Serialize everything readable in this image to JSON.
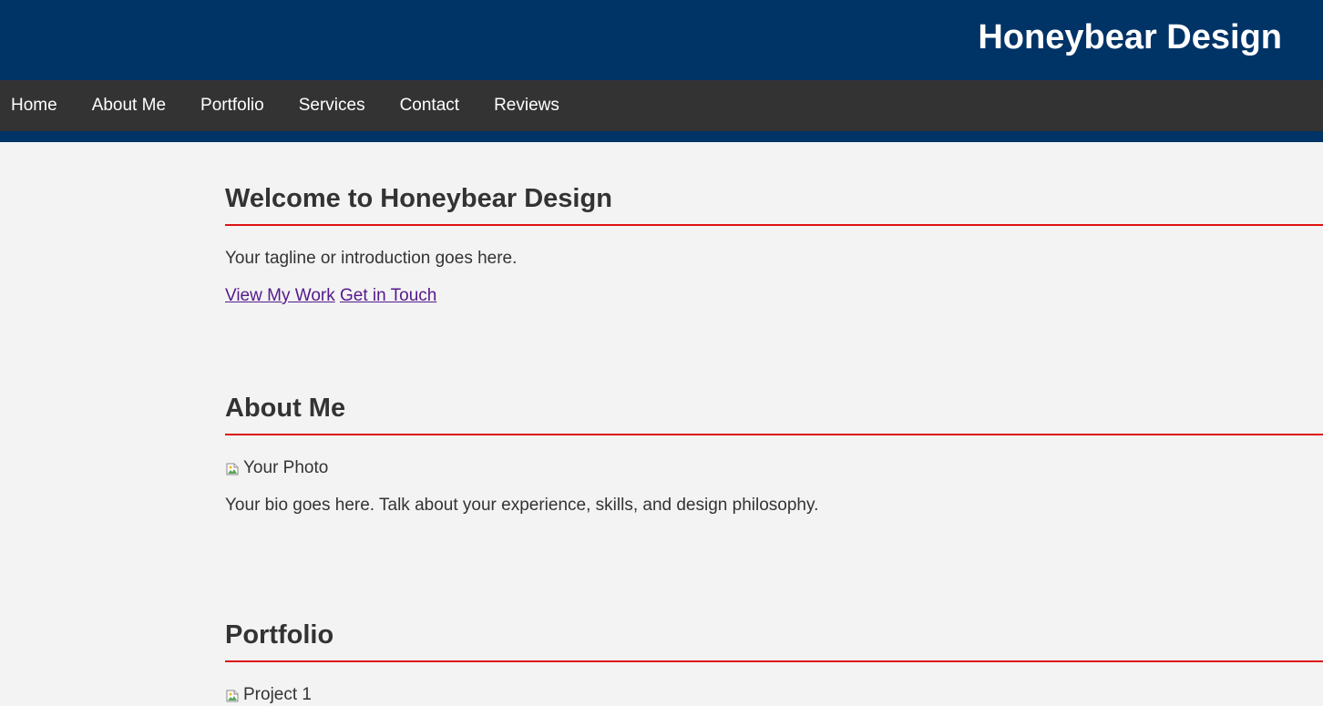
{
  "header": {
    "title": "Honeybear Design"
  },
  "nav": {
    "items": [
      {
        "label": "Home"
      },
      {
        "label": "About Me"
      },
      {
        "label": "Portfolio"
      },
      {
        "label": "Services"
      },
      {
        "label": "Contact"
      },
      {
        "label": "Reviews"
      }
    ]
  },
  "sections": {
    "welcome": {
      "title": "Welcome to Honeybear Design",
      "tagline": "Your tagline or introduction goes here.",
      "links": [
        {
          "label": "View My Work"
        },
        {
          "label": "Get in Touch"
        }
      ]
    },
    "about": {
      "title": "About Me",
      "photo_alt": "Your Photo",
      "bio": "Your bio goes here. Talk about your experience, skills, and design philosophy."
    },
    "portfolio": {
      "title": "Portfolio",
      "project_1_alt": "Project 1"
    }
  },
  "colors": {
    "header_background": "#003366",
    "nav_background": "#333333",
    "page_background": "#f3f3f3",
    "section_rule": "#dd1111",
    "link": "#551a8b"
  },
  "icons": {
    "broken_image": "broken-image-icon"
  }
}
